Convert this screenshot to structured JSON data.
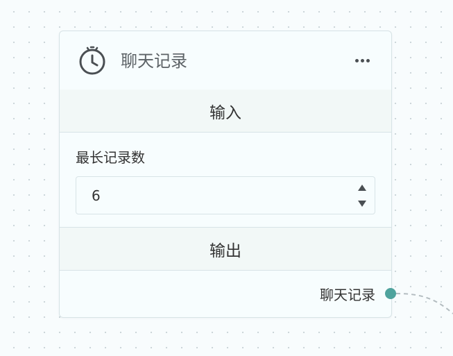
{
  "node": {
    "title": "聊天记录",
    "icon": "timer-icon",
    "menu_icon": "more-icon"
  },
  "input_section": {
    "label": "输入",
    "fields": [
      {
        "label": "最长记录数",
        "value": "6"
      }
    ]
  },
  "output_section": {
    "label": "输出",
    "outputs": [
      {
        "label": "聊天记录"
      }
    ]
  },
  "colors": {
    "handle": "#4fa39d",
    "section_bg": "#f2f8f7",
    "border": "#d7e3e6"
  }
}
